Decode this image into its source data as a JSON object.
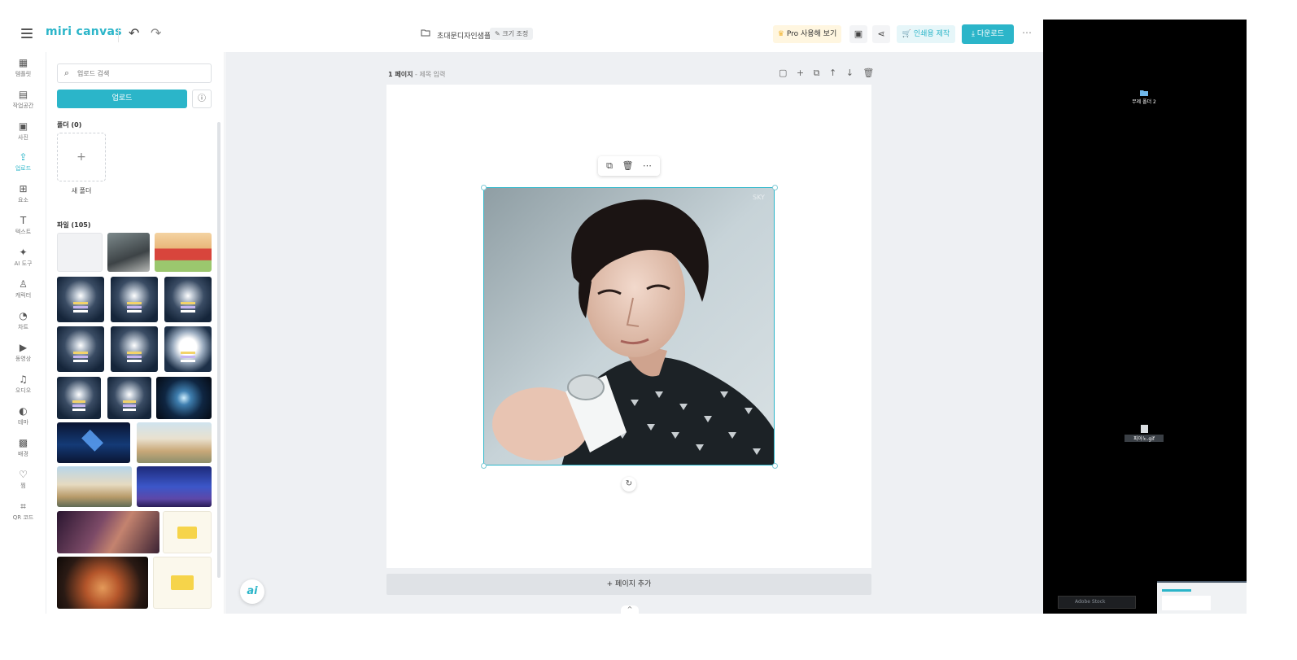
{
  "topbar": {
    "logo": "miri canvas",
    "undo_icon": "↶",
    "redo_icon": "↷",
    "doc_title": "초대문디자인샘플",
    "resize_label": "✎ 크기 조정",
    "pro_label": "Pro 사용해 보기",
    "print_label": "인쇄용 제작",
    "download_label": "다운로드",
    "more_icon": "⋯"
  },
  "rail": {
    "items": [
      {
        "icon": "▦",
        "label": "템플릿"
      },
      {
        "icon": "▤",
        "label": "작업공간"
      },
      {
        "icon": "▣",
        "label": "사진"
      },
      {
        "icon": "⇪",
        "label": "업로드"
      },
      {
        "icon": "⊞",
        "label": "요소"
      },
      {
        "icon": "T",
        "label": "텍스트"
      },
      {
        "icon": "✦",
        "label": "AI 도구"
      },
      {
        "icon": "♙",
        "label": "캐릭터"
      },
      {
        "icon": "◔",
        "label": "차트"
      },
      {
        "icon": "▶",
        "label": "동영상"
      },
      {
        "icon": "♫",
        "label": "오디오"
      },
      {
        "icon": "◐",
        "label": "테마"
      },
      {
        "icon": "▩",
        "label": "배경"
      },
      {
        "icon": "♡",
        "label": "찜"
      },
      {
        "icon": "⌗",
        "label": "QR 코드"
      }
    ],
    "active_index": 3
  },
  "panel": {
    "search_placeholder": "업로드 검색",
    "upload_label": "업로드",
    "info_icon": "ⓘ",
    "folders_label": "폴더 (0)",
    "new_folder_icon": "+",
    "new_folder_label": "새 폴더",
    "files_label": "파일 (105)"
  },
  "workspace": {
    "page_number": "1 페이지",
    "page_title_placeholder": " - 제목 입력",
    "page_tools": [
      "▢",
      "+",
      "⧉",
      "↑",
      "↓",
      "🗑"
    ],
    "float_bar": [
      "⧉",
      "🗑",
      "⋯"
    ],
    "add_page_label": "+ 페이지 추가",
    "ai_label": "ai",
    "rotate_icon": "↻",
    "collapse_icon": "^"
  },
  "desktop": {
    "folder_label": "무제 폴더 2",
    "file_label": "피아노.gif",
    "taskbar_search": "Adobe Stock"
  },
  "colors": {
    "accent": "#2bb5c9",
    "pro_bg": "#fff6e0",
    "workspace_bg": "#eef0f3"
  }
}
